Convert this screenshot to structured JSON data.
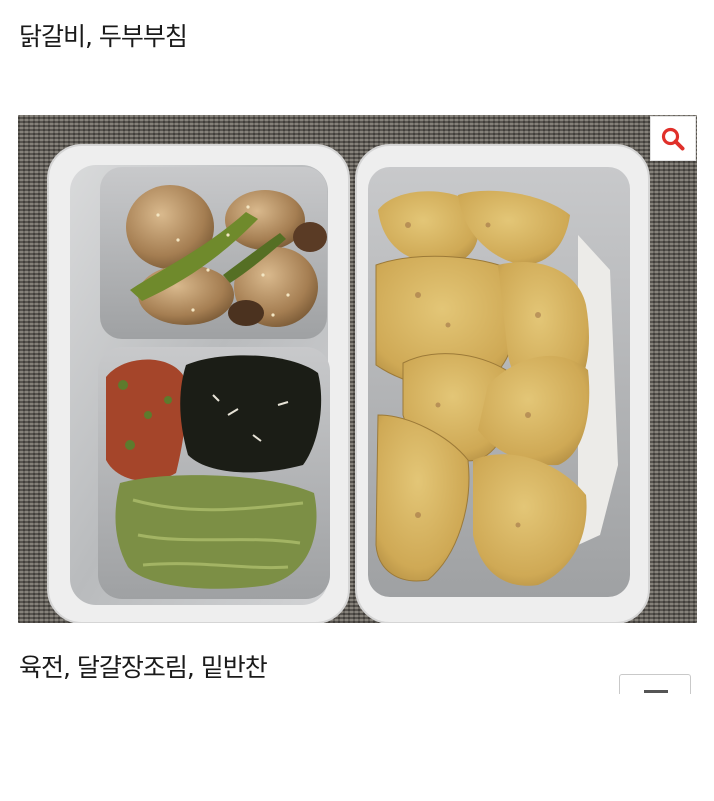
{
  "post": {
    "caption_top": "닭갈비, 두부부침",
    "caption_bottom": "육전, 달걀장조림, 밑반찬"
  },
  "photo": {
    "zoom_icon": "search-icon",
    "accent_color": "#e0302a"
  }
}
